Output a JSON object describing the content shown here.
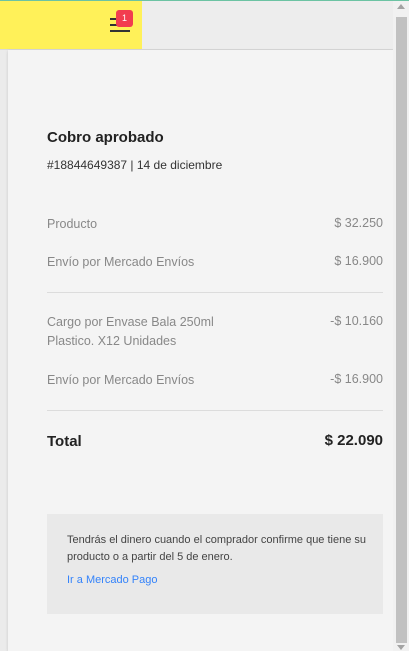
{
  "header": {
    "notification_count": "1"
  },
  "payment": {
    "title": "Cobro aprobado",
    "subtitle": "#18844649387 | 14 de diciembre"
  },
  "charges": [
    {
      "label": "Producto",
      "value": "$ 32.250"
    },
    {
      "label": "Envío por Mercado Envíos",
      "value": "$ 16.900"
    }
  ],
  "deductions": [
    {
      "label": "Cargo por Envase Bala 250ml Plastico. X12 Unidades",
      "value": "-$ 10.160"
    },
    {
      "label": "Envío por Mercado Envíos",
      "value": "-$ 16.900"
    }
  ],
  "total": {
    "label": "Total",
    "value": "$ 22.090"
  },
  "info": {
    "text": "Tendrás el dinero cuando el comprador confirme que tiene su producto o a partir del 5 de enero.",
    "link": "Ir a Mercado Pago"
  },
  "colors": {
    "brand_yellow": "#fff159",
    "badge_red": "#f23d4f",
    "link_blue": "#3483fa"
  }
}
